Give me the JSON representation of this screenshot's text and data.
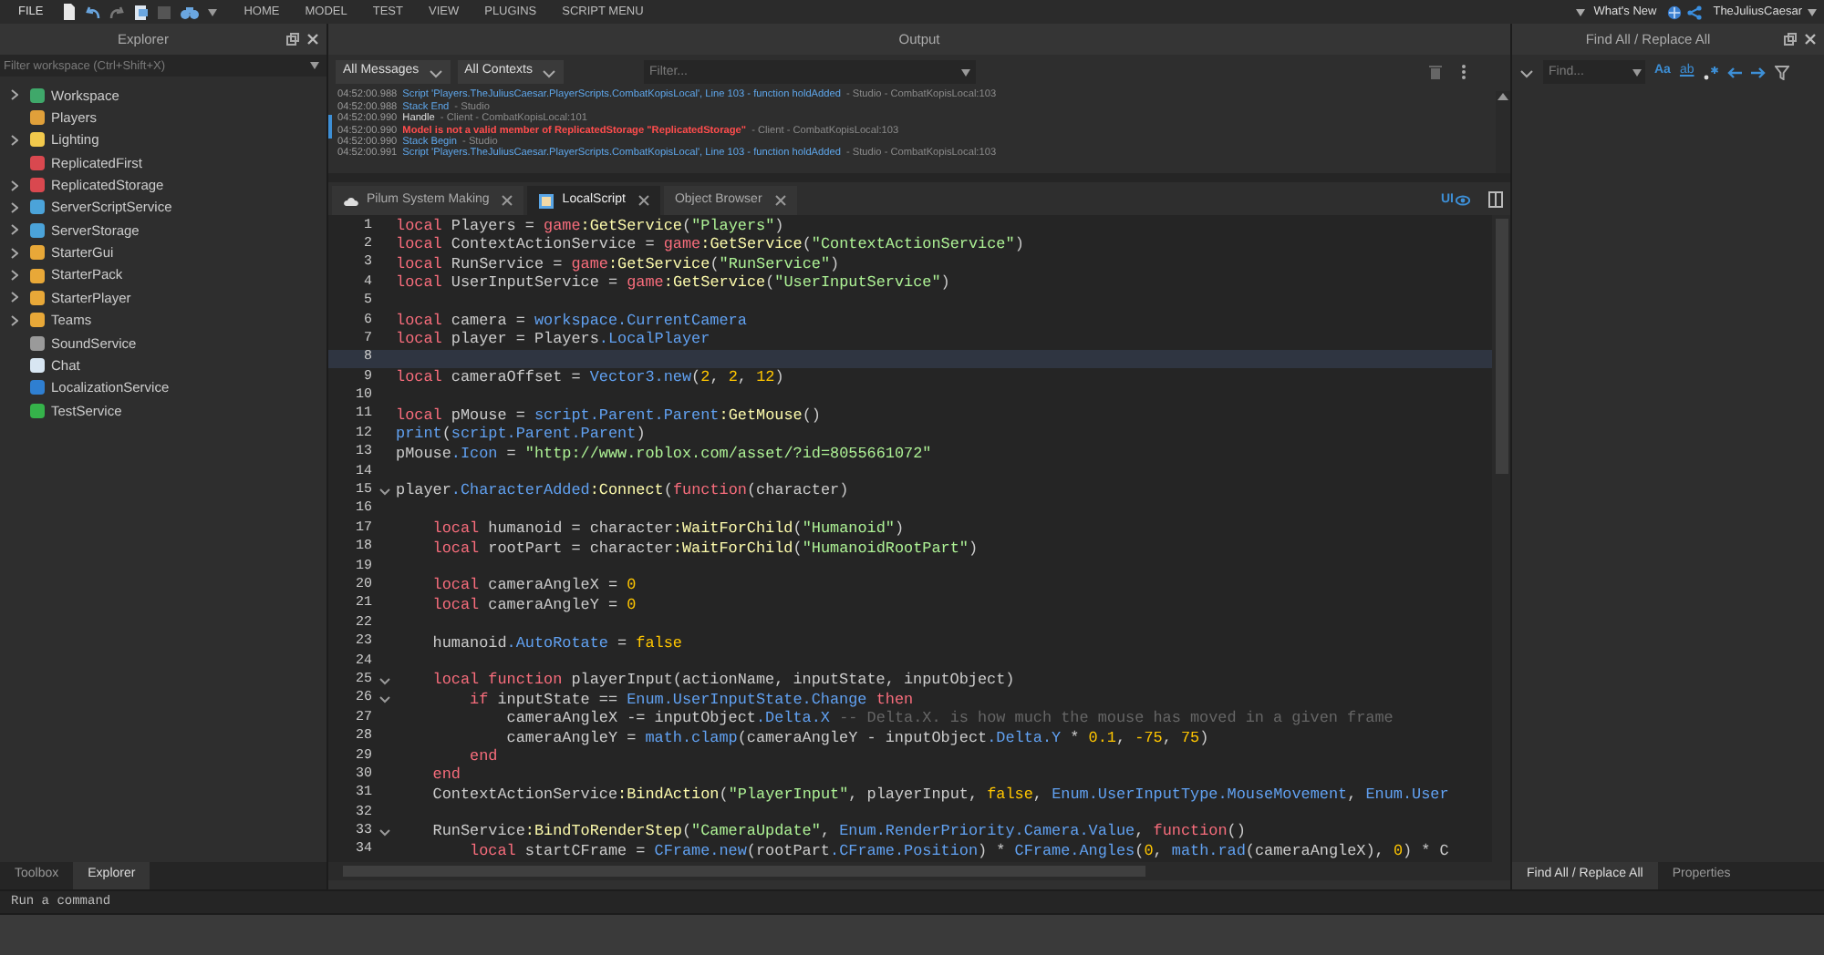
{
  "menu": {
    "file": "FILE",
    "tabs": [
      "HOME",
      "MODEL",
      "TEST",
      "VIEW",
      "PLUGINS",
      "SCRIPT MENU"
    ],
    "whats_new": "What's New",
    "user": "TheJuliusCaesar"
  },
  "explorer": {
    "title": "Explorer",
    "filter_placeholder": "Filter workspace (Ctrl+Shift+X)",
    "items": [
      {
        "label": "Workspace",
        "expandable": true,
        "color": "#3fa86a"
      },
      {
        "label": "Players",
        "expandable": false,
        "color": "#e0a03a"
      },
      {
        "label": "Lighting",
        "expandable": true,
        "color": "#f2c94c"
      },
      {
        "label": "ReplicatedFirst",
        "expandable": false,
        "color": "#d9484f"
      },
      {
        "label": "ReplicatedStorage",
        "expandable": true,
        "color": "#d9484f"
      },
      {
        "label": "ServerScriptService",
        "expandable": true,
        "color": "#4ba3d9"
      },
      {
        "label": "ServerStorage",
        "expandable": true,
        "color": "#4ba3d9"
      },
      {
        "label": "StarterGui",
        "expandable": true,
        "color": "#e8a838"
      },
      {
        "label": "StarterPack",
        "expandable": true,
        "color": "#e8a838"
      },
      {
        "label": "StarterPlayer",
        "expandable": true,
        "color": "#e8a838"
      },
      {
        "label": "Teams",
        "expandable": true,
        "color": "#e8a838"
      },
      {
        "label": "SoundService",
        "expandable": false,
        "color": "#9a9a9a"
      },
      {
        "label": "Chat",
        "expandable": false,
        "color": "#d8e6f2"
      },
      {
        "label": "LocalizationService",
        "expandable": false,
        "color": "#2f7fd1"
      },
      {
        "label": "TestService",
        "expandable": false,
        "color": "#35b24a"
      }
    ]
  },
  "left_tabs": [
    {
      "label": "Toolbox",
      "selected": false
    },
    {
      "label": "Explorer",
      "selected": true
    }
  ],
  "output": {
    "title": "Output",
    "message_filter": "All Messages",
    "context_filter": "All Contexts",
    "filter_placeholder": "Filter...",
    "messages": [
      {
        "time": "04:52:00.988",
        "kind": "info",
        "text": "Script 'Players.TheJuliusCaesar.PlayerScripts.CombatKopisLocal', Line 103 - function holdAdded",
        "source": "- Studio - CombatKopisLocal:103",
        "marked": false
      },
      {
        "time": "04:52:00.988",
        "kind": "info",
        "text": "Stack End",
        "source": "- Studio",
        "marked": false
      },
      {
        "time": "04:52:00.990",
        "kind": "plain",
        "text": "Handle",
        "source": "- Client - CombatKopisLocal:101",
        "marked": true
      },
      {
        "time": "04:52:00.990",
        "kind": "error",
        "text": "Model is not a valid member of ReplicatedStorage \"ReplicatedStorage\"",
        "source": "- Client - CombatKopisLocal:103",
        "marked": true
      },
      {
        "time": "04:52:00.990",
        "kind": "info",
        "text": "Stack Begin",
        "source": "- Studio",
        "marked": false
      },
      {
        "time": "04:52:00.991",
        "kind": "info",
        "text": "Script 'Players.TheJuliusCaesar.PlayerScripts.CombatKopisLocal', Line 103 - function holdAdded",
        "source": "- Studio - CombatKopisLocal:103",
        "marked": false
      }
    ]
  },
  "editor": {
    "tabs": [
      {
        "label": "Pilum System Making",
        "kind": "place",
        "selected": false
      },
      {
        "label": "LocalScript",
        "kind": "script",
        "selected": true
      },
      {
        "label": "Object Browser",
        "kind": "browser",
        "selected": false
      }
    ],
    "ui_toggle": "UI",
    "lines": [
      {
        "number": "1",
        "fold": false,
        "current": false,
        "tokens": [
          {
            "kind": "kw",
            "text": "local"
          },
          {
            "kind": "text",
            "text": " Players = "
          },
          {
            "kind": "kw",
            "text": "game"
          },
          {
            "kind": "call",
            "text": ":GetService"
          },
          {
            "kind": "text",
            "text": "("
          },
          {
            "kind": "str",
            "text": "\"Players\""
          },
          {
            "kind": "text",
            "text": ")"
          }
        ]
      },
      {
        "number": "2",
        "fold": false,
        "current": false,
        "tokens": [
          {
            "kind": "kw",
            "text": "local"
          },
          {
            "kind": "text",
            "text": " ContextActionService = "
          },
          {
            "kind": "kw",
            "text": "game"
          },
          {
            "kind": "call",
            "text": ":GetService"
          },
          {
            "kind": "text",
            "text": "("
          },
          {
            "kind": "str",
            "text": "\"ContextActionService\""
          },
          {
            "kind": "text",
            "text": ")"
          }
        ]
      },
      {
        "number": "3",
        "fold": false,
        "current": false,
        "tokens": [
          {
            "kind": "kw",
            "text": "local"
          },
          {
            "kind": "text",
            "text": " RunService = "
          },
          {
            "kind": "kw",
            "text": "game"
          },
          {
            "kind": "call",
            "text": ":GetService"
          },
          {
            "kind": "text",
            "text": "("
          },
          {
            "kind": "str",
            "text": "\"RunService\""
          },
          {
            "kind": "text",
            "text": ")"
          }
        ]
      },
      {
        "number": "4",
        "fold": false,
        "current": false,
        "tokens": [
          {
            "kind": "kw",
            "text": "local"
          },
          {
            "kind": "text",
            "text": " UserInputService = "
          },
          {
            "kind": "kw",
            "text": "game"
          },
          {
            "kind": "call",
            "text": ":GetService"
          },
          {
            "kind": "text",
            "text": "("
          },
          {
            "kind": "str",
            "text": "\"UserInputService\""
          },
          {
            "kind": "text",
            "text": ")"
          }
        ]
      },
      {
        "number": "5",
        "fold": false,
        "current": false
      },
      {
        "number": "6",
        "fold": false,
        "current": false,
        "tokens": [
          {
            "kind": "kw",
            "text": "local"
          },
          {
            "kind": "text",
            "text": " camera = "
          },
          {
            "kind": "prop",
            "text": "workspace.CurrentCamera"
          }
        ]
      },
      {
        "number": "7",
        "fold": false,
        "current": false,
        "tokens": [
          {
            "kind": "kw",
            "text": "local"
          },
          {
            "kind": "text",
            "text": " player = Players"
          },
          {
            "kind": "prop",
            "text": ".LocalPlayer"
          }
        ]
      },
      {
        "number": "8",
        "fold": false,
        "current": true
      },
      {
        "number": "9",
        "fold": false,
        "current": false,
        "tokens": [
          {
            "kind": "kw",
            "text": "local"
          },
          {
            "kind": "text",
            "text": " cameraOffset = "
          },
          {
            "kind": "prop",
            "text": "Vector3.new"
          },
          {
            "kind": "text",
            "text": "("
          },
          {
            "kind": "num",
            "text": "2"
          },
          {
            "kind": "text",
            "text": ", "
          },
          {
            "kind": "num",
            "text": "2"
          },
          {
            "kind": "text",
            "text": ", "
          },
          {
            "kind": "num",
            "text": "12"
          },
          {
            "kind": "text",
            "text": ")"
          }
        ]
      },
      {
        "number": "10",
        "fold": false,
        "current": false
      },
      {
        "number": "11",
        "fold": false,
        "current": false,
        "tokens": [
          {
            "kind": "kw",
            "text": "local"
          },
          {
            "kind": "text",
            "text": " pMouse = "
          },
          {
            "kind": "prop",
            "text": "script.Parent.Parent"
          },
          {
            "kind": "call",
            "text": ":GetMouse"
          },
          {
            "kind": "text",
            "text": "()"
          }
        ]
      },
      {
        "number": "12",
        "fold": false,
        "current": false,
        "tokens": [
          {
            "kind": "prop",
            "text": "print"
          },
          {
            "kind": "text",
            "text": "("
          },
          {
            "kind": "prop",
            "text": "script.Parent.Parent"
          },
          {
            "kind": "text",
            "text": ")"
          }
        ]
      },
      {
        "number": "13",
        "fold": false,
        "current": false,
        "tokens": [
          {
            "kind": "text",
            "text": "pMouse"
          },
          {
            "kind": "prop",
            "text": ".Icon"
          },
          {
            "kind": "text",
            "text": " = "
          },
          {
            "kind": "str",
            "text": "\"http://www.roblox.com/asset/?id=8055661072\""
          }
        ]
      },
      {
        "number": "14",
        "fold": false,
        "current": false
      },
      {
        "number": "15",
        "fold": true,
        "current": false,
        "tokens": [
          {
            "kind": "text",
            "text": "player"
          },
          {
            "kind": "prop",
            "text": ".CharacterAdded"
          },
          {
            "kind": "call",
            "text": ":Connect"
          },
          {
            "kind": "text",
            "text": "("
          },
          {
            "kind": "kw",
            "text": "function"
          },
          {
            "kind": "text",
            "text": "(character)"
          }
        ]
      },
      {
        "number": "16",
        "fold": false,
        "current": false
      },
      {
        "number": "17",
        "fold": false,
        "current": false,
        "tokens": [
          {
            "kind": "kw",
            "text": "    local"
          },
          {
            "kind": "text",
            "text": " humanoid = character"
          },
          {
            "kind": "call",
            "text": ":WaitForChild"
          },
          {
            "kind": "text",
            "text": "("
          },
          {
            "kind": "str",
            "text": "\"Humanoid\""
          },
          {
            "kind": "text",
            "text": ")"
          }
        ]
      },
      {
        "number": "18",
        "fold": false,
        "current": false,
        "tokens": [
          {
            "kind": "kw",
            "text": "    local"
          },
          {
            "kind": "text",
            "text": " rootPart = character"
          },
          {
            "kind": "call",
            "text": ":WaitForChild"
          },
          {
            "kind": "text",
            "text": "("
          },
          {
            "kind": "str",
            "text": "\"HumanoidRootPart\""
          },
          {
            "kind": "text",
            "text": ")"
          }
        ]
      },
      {
        "number": "19",
        "fold": false,
        "current": false
      },
      {
        "number": "20",
        "fold": false,
        "current": false,
        "tokens": [
          {
            "kind": "kw",
            "text": "    local"
          },
          {
            "kind": "text",
            "text": " cameraAngleX = "
          },
          {
            "kind": "num",
            "text": "0"
          }
        ]
      },
      {
        "number": "21",
        "fold": false,
        "current": false,
        "tokens": [
          {
            "kind": "kw",
            "text": "    local"
          },
          {
            "kind": "text",
            "text": " cameraAngleY = "
          },
          {
            "kind": "num",
            "text": "0"
          }
        ]
      },
      {
        "number": "22",
        "fold": false,
        "current": false
      },
      {
        "number": "23",
        "fold": false,
        "current": false,
        "tokens": [
          {
            "kind": "text",
            "text": "    humanoid"
          },
          {
            "kind": "prop",
            "text": ".AutoRotate"
          },
          {
            "kind": "text",
            "text": " = "
          },
          {
            "kind": "num",
            "text": "false"
          }
        ]
      },
      {
        "number": "24",
        "fold": false,
        "current": false
      },
      {
        "number": "25",
        "fold": true,
        "current": false,
        "tokens": [
          {
            "kind": "kw",
            "text": "    local function"
          },
          {
            "kind": "text",
            "text": " playerInput(actionName, inputState, inputObject)"
          }
        ]
      },
      {
        "number": "26",
        "fold": true,
        "current": false,
        "tokens": [
          {
            "kind": "kw",
            "text": "        if"
          },
          {
            "kind": "text",
            "text": " inputState == "
          },
          {
            "kind": "prop",
            "text": "Enum.UserInputState.Change"
          },
          {
            "kind": "kw",
            "text": " then"
          }
        ]
      },
      {
        "number": "27",
        "fold": false,
        "current": false,
        "tokens": [
          {
            "kind": "text",
            "text": "            cameraAngleX -= inputObject"
          },
          {
            "kind": "prop",
            "text": ".Delta.X"
          },
          {
            "kind": "cmt",
            "text": " -- Delta.X. is how much the mouse has moved in a given frame"
          }
        ]
      },
      {
        "number": "28",
        "fold": false,
        "current": false,
        "tokens": [
          {
            "kind": "text",
            "text": "            cameraAngleY = "
          },
          {
            "kind": "prop",
            "text": "math.clamp"
          },
          {
            "kind": "text",
            "text": "(cameraAngleY - inputObject"
          },
          {
            "kind": "prop",
            "text": ".Delta.Y"
          },
          {
            "kind": "text",
            "text": " * "
          },
          {
            "kind": "num",
            "text": "0.1"
          },
          {
            "kind": "text",
            "text": ", "
          },
          {
            "kind": "num",
            "text": "-75"
          },
          {
            "kind": "text",
            "text": ", "
          },
          {
            "kind": "num",
            "text": "75"
          },
          {
            "kind": "text",
            "text": ")"
          }
        ]
      },
      {
        "number": "29",
        "fold": false,
        "current": false,
        "tokens": [
          {
            "kind": "kw",
            "text": "        end"
          }
        ]
      },
      {
        "number": "30",
        "fold": false,
        "current": false,
        "tokens": [
          {
            "kind": "kw",
            "text": "    end"
          }
        ]
      },
      {
        "number": "31",
        "fold": false,
        "current": false,
        "tokens": [
          {
            "kind": "text",
            "text": "    ContextActionService"
          },
          {
            "kind": "call",
            "text": ":BindAction"
          },
          {
            "kind": "text",
            "text": "("
          },
          {
            "kind": "str",
            "text": "\"PlayerInput\""
          },
          {
            "kind": "text",
            "text": ", playerInput, "
          },
          {
            "kind": "num",
            "text": "false"
          },
          {
            "kind": "text",
            "text": ", "
          },
          {
            "kind": "prop",
            "text": "Enum.UserInputType.MouseMovement"
          },
          {
            "kind": "text",
            "text": ", "
          },
          {
            "kind": "prop",
            "text": "Enum.User"
          }
        ]
      },
      {
        "number": "32",
        "fold": false,
        "current": false
      },
      {
        "number": "33",
        "fold": true,
        "current": false,
        "tokens": [
          {
            "kind": "text",
            "text": "    RunService"
          },
          {
            "kind": "call",
            "text": ":BindToRenderStep"
          },
          {
            "kind": "text",
            "text": "("
          },
          {
            "kind": "str",
            "text": "\"CameraUpdate\""
          },
          {
            "kind": "text",
            "text": ", "
          },
          {
            "kind": "prop",
            "text": "Enum.RenderPriority.Camera.Value"
          },
          {
            "kind": "text",
            "text": ", "
          },
          {
            "kind": "kw",
            "text": "function"
          },
          {
            "kind": "text",
            "text": "()"
          }
        ]
      },
      {
        "number": "34",
        "fold": false,
        "current": false,
        "tokens": [
          {
            "kind": "kw",
            "text": "        local"
          },
          {
            "kind": "text",
            "text": " startCFrame = "
          },
          {
            "kind": "prop",
            "text": "CFrame.new"
          },
          {
            "kind": "text",
            "text": "(rootPart"
          },
          {
            "kind": "prop",
            "text": ".CFrame.Position"
          },
          {
            "kind": "text",
            "text": ") * "
          },
          {
            "kind": "prop",
            "text": "CFrame.Angles"
          },
          {
            "kind": "text",
            "text": "("
          },
          {
            "kind": "num",
            "text": "0"
          },
          {
            "kind": "text",
            "text": ", "
          },
          {
            "kind": "prop",
            "text": "math.rad"
          },
          {
            "kind": "text",
            "text": "(cameraAngleX), "
          },
          {
            "kind": "num",
            "text": "0"
          },
          {
            "kind": "text",
            "text": ") * C"
          }
        ]
      }
    ]
  },
  "find": {
    "title": "Find All / Replace All",
    "placeholder": "Find...",
    "match_case": "Aa",
    "whole_word": "ab"
  },
  "right_tabs": [
    {
      "label": "Find All / Replace All",
      "selected": true
    },
    {
      "label": "Properties",
      "selected": false
    }
  ],
  "command": {
    "placeholder": "Run a command"
  }
}
